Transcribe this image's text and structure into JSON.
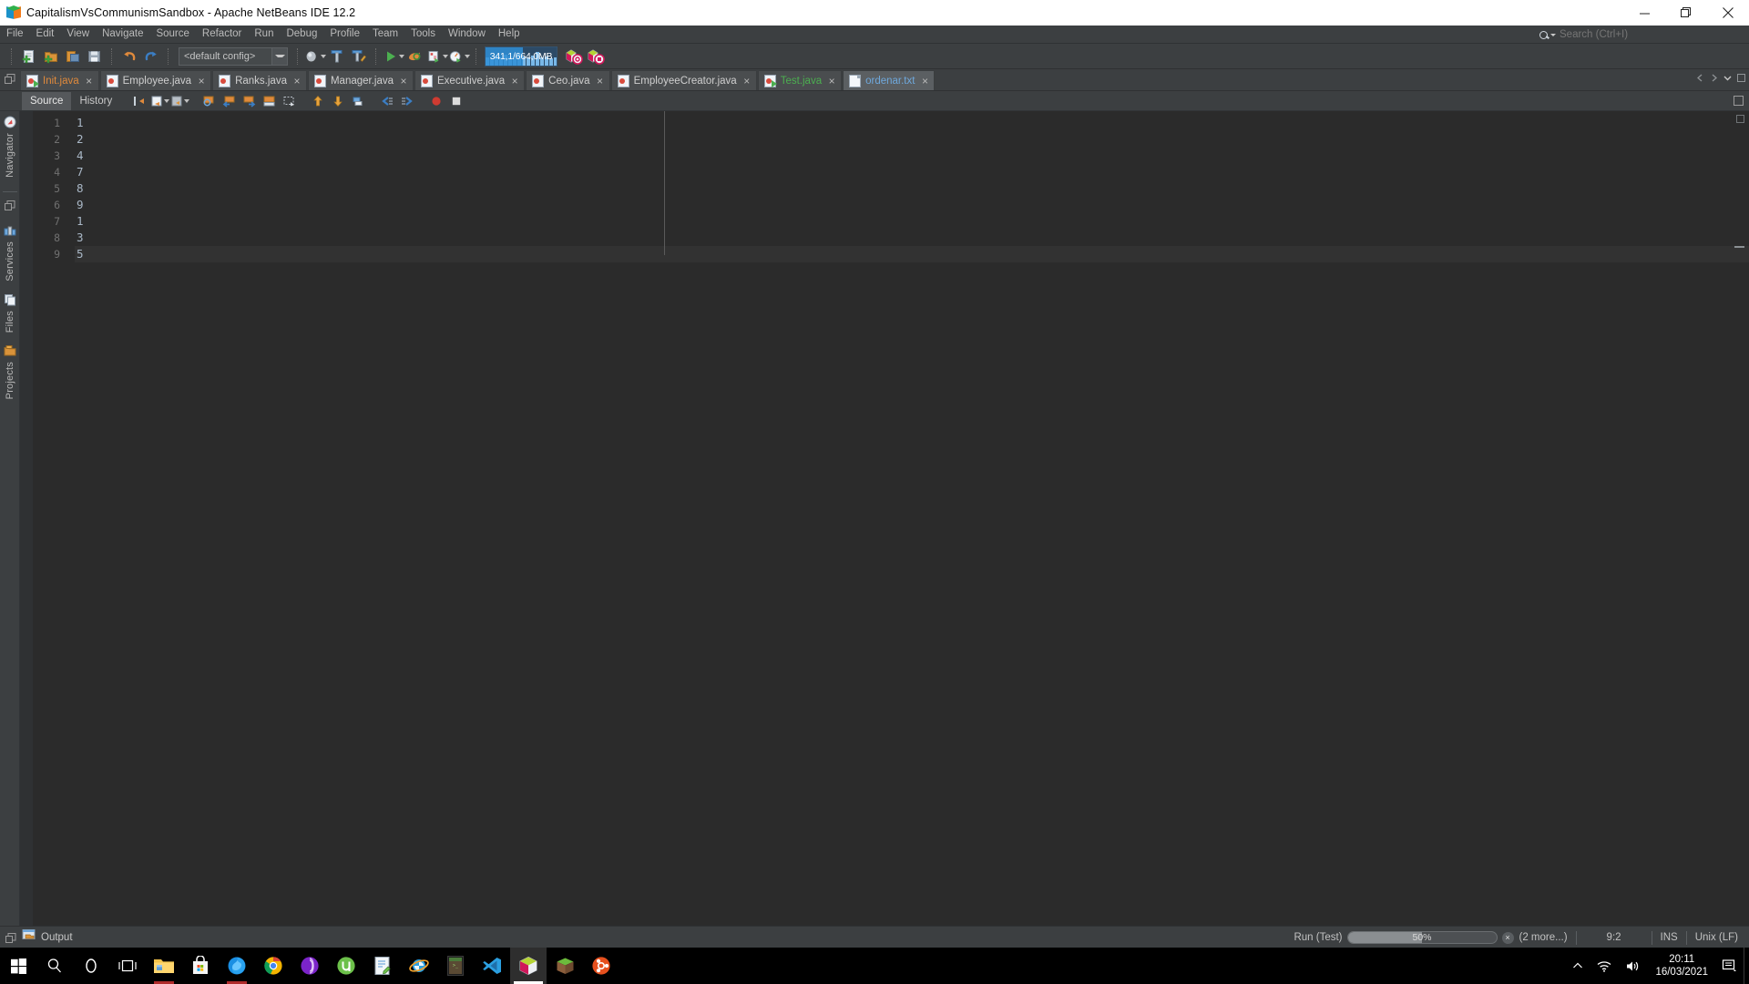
{
  "window": {
    "title": "CapitalismVsCommunismSandbox - Apache NetBeans IDE 12.2",
    "logo_name": "netbeans-logo",
    "minimize_label": "Minimize",
    "maximize_label": "Restore",
    "close_label": "Close"
  },
  "menubar": {
    "items": [
      {
        "label": "File",
        "mnemonic": "F"
      },
      {
        "label": "Edit",
        "mnemonic": "E"
      },
      {
        "label": "View",
        "mnemonic": "V"
      },
      {
        "label": "Navigate",
        "mnemonic": "N"
      },
      {
        "label": "Source",
        "mnemonic": "S"
      },
      {
        "label": "Refactor",
        "mnemonic": "R"
      },
      {
        "label": "Run",
        "mnemonic": "R"
      },
      {
        "label": "Debug",
        "mnemonic": "D"
      },
      {
        "label": "Profile",
        "mnemonic": "P"
      },
      {
        "label": "Team",
        "mnemonic": "m"
      },
      {
        "label": "Tools",
        "mnemonic": "T"
      },
      {
        "label": "Window",
        "mnemonic": "W"
      },
      {
        "label": "Help",
        "mnemonic": "H"
      }
    ]
  },
  "search": {
    "placeholder": "Search (Ctrl+I)",
    "value": "",
    "icon": "search-icon"
  },
  "toolbar": {
    "buttons": [
      {
        "name": "new-file-button",
        "icon": "new-file-icon"
      },
      {
        "name": "new-project-button",
        "icon": "new-project-icon"
      },
      {
        "name": "open-project-button",
        "icon": "open-project-icon"
      },
      {
        "name": "save-all-button",
        "icon": "save-all-icon"
      },
      {
        "name": "undo-button",
        "icon": "undo-icon"
      },
      {
        "name": "redo-button",
        "icon": "redo-icon"
      }
    ],
    "config_combo": {
      "value": "<default config>",
      "name": "project-configuration-combo"
    },
    "run_buttons": [
      {
        "name": "build-project-button",
        "icon": "hammer-icon"
      },
      {
        "name": "clean-build-button",
        "icon": "hammer-broom-icon"
      },
      {
        "name": "run-project-button",
        "icon": "run-play-icon"
      },
      {
        "name": "debug-project-button",
        "icon": "debug-icon"
      },
      {
        "name": "profile-project-button",
        "icon": "profile-icon"
      },
      {
        "name": "test-project-button",
        "icon": "gauge-icon"
      }
    ],
    "memory": {
      "label": "341,1/664,0MB",
      "percent": 52,
      "name": "heap-memory-gauge"
    },
    "right_buttons": [
      {
        "name": "profile-history-button",
        "icon": "profile-history-icon"
      },
      {
        "name": "profile-stop-button",
        "icon": "profile-stop-icon"
      }
    ]
  },
  "editor_tabs": {
    "items": [
      {
        "label": "Init.java",
        "icon": "java-main-file-icon",
        "color": "#e08a3c",
        "selected": false,
        "runnable": true
      },
      {
        "label": "Employee.java",
        "icon": "java-file-icon",
        "color": "#cfcfcf",
        "selected": false,
        "runnable": false
      },
      {
        "label": "Ranks.java",
        "icon": "java-file-icon",
        "color": "#cfcfcf",
        "selected": false,
        "runnable": false
      },
      {
        "label": "Manager.java",
        "icon": "java-file-icon",
        "color": "#cfcfcf",
        "selected": false,
        "runnable": false
      },
      {
        "label": "Executive.java",
        "icon": "java-file-icon",
        "color": "#cfcfcf",
        "selected": false,
        "runnable": false
      },
      {
        "label": "Ceo.java",
        "icon": "java-file-icon",
        "color": "#cfcfcf",
        "selected": false,
        "runnable": false
      },
      {
        "label": "EmployeeCreator.java",
        "icon": "java-file-icon",
        "color": "#cfcfcf",
        "selected": false,
        "runnable": false
      },
      {
        "label": "Test.java",
        "icon": "java-main-file-icon",
        "color": "#4caf50",
        "selected": false,
        "runnable": true
      },
      {
        "label": "ordenar.txt",
        "icon": "text-file-icon",
        "color": "#6fa8dc",
        "selected": true,
        "runnable": false
      }
    ],
    "close_glyph": "×"
  },
  "editor_toolbar": {
    "tabs": [
      {
        "label": "Source",
        "active": true,
        "name": "tab-source"
      },
      {
        "label": "History",
        "active": false,
        "name": "tab-history"
      }
    ],
    "buttons": [
      {
        "name": "last-edit-button",
        "icon": "last-edit-icon"
      },
      {
        "name": "toggle-bookmark-button",
        "icon": "bookmark-icon"
      },
      {
        "name": "toggle-rect-select-button",
        "icon": "rect-select-icon"
      },
      {
        "name": "find-selection-button",
        "icon": "find-selection-icon"
      },
      {
        "name": "previous-bookmark-button",
        "icon": "arrow-left-icon"
      },
      {
        "name": "next-bookmark-button",
        "icon": "arrow-right-icon"
      },
      {
        "name": "toggle-highlight-button",
        "icon": "highlight-icon"
      },
      {
        "name": "rectangular-selection-button",
        "icon": "dashed-rect-icon"
      },
      {
        "name": "previous-error-button",
        "icon": "arrow-up-icon"
      },
      {
        "name": "next-error-button",
        "icon": "arrow-down-icon"
      },
      {
        "name": "shift-right-button",
        "icon": "shift-right-icon"
      },
      {
        "name": "back-button",
        "icon": "back-arrow-icon"
      },
      {
        "name": "forward-button",
        "icon": "forward-arrow-icon"
      },
      {
        "name": "record-macro-button",
        "icon": "record-icon"
      },
      {
        "name": "stop-macro-button",
        "icon": "stop-icon"
      }
    ],
    "right_button": {
      "name": "maximize-editor-button",
      "icon": "maximize-window-icon"
    }
  },
  "left_rail": {
    "items": [
      {
        "label": "Navigator",
        "icon": "compass-icon",
        "name": "sidebar-item-navigator"
      },
      {
        "label": "Services",
        "icon": "services-icon",
        "name": "sidebar-item-services"
      },
      {
        "label": "Files",
        "icon": "files-icon",
        "name": "sidebar-item-files"
      },
      {
        "label": "Projects",
        "icon": "projects-icon",
        "name": "sidebar-item-projects"
      }
    ],
    "top_icon": {
      "name": "window-group-icon",
      "icon": "window-group-icon"
    }
  },
  "editor": {
    "file": "ordenar.txt",
    "lines": [
      {
        "number": "1",
        "text": "1",
        "current": false
      },
      {
        "number": "2",
        "text": "2",
        "current": false
      },
      {
        "number": "3",
        "text": "4",
        "current": false
      },
      {
        "number": "4",
        "text": "7",
        "current": false
      },
      {
        "number": "5",
        "text": "8",
        "current": false
      },
      {
        "number": "6",
        "text": "9",
        "current": false
      },
      {
        "number": "7",
        "text": "1",
        "current": false
      },
      {
        "number": "8",
        "text": "3",
        "current": false
      },
      {
        "number": "9",
        "text": "5",
        "current": true
      }
    ]
  },
  "statusbar": {
    "output_label": "Output",
    "output_icon": "output-window-icon",
    "run_task_label": "Run (Test)",
    "progress_text": "50%",
    "progress_percent": 50,
    "cancel_glyph": "×",
    "more_tasks_label": "(2 more...)",
    "caret_position": "9:2",
    "insert_mode": "INS",
    "line_ending": "Unix (LF)"
  },
  "taskbar": {
    "icons": [
      {
        "name": "start-button",
        "icon": "windows-logo-icon"
      },
      {
        "name": "search-taskbar-button",
        "icon": "search-icon"
      },
      {
        "name": "cortana-button",
        "icon": "cortana-circle-icon"
      },
      {
        "name": "task-view-button",
        "icon": "task-view-icon"
      },
      {
        "name": "file-explorer-button",
        "icon": "folder-icon"
      },
      {
        "name": "microsoft-store-button",
        "icon": "store-bag-icon"
      },
      {
        "name": "firefox-button",
        "icon": "firefox-icon"
      },
      {
        "name": "chrome-button",
        "icon": "chrome-icon"
      },
      {
        "name": "opera-button",
        "icon": "opera-icon"
      },
      {
        "name": "utorrent-button",
        "icon": "utorrent-icon"
      },
      {
        "name": "notepad-button",
        "icon": "notepad-icon"
      },
      {
        "name": "internet-explorer-button",
        "icon": "internet-explorer-icon"
      },
      {
        "name": "terminal-button",
        "icon": "terminal-icon"
      },
      {
        "name": "vscode-button",
        "icon": "vscode-icon"
      },
      {
        "name": "netbeans-button",
        "icon": "netbeans-logo-icon"
      },
      {
        "name": "minecraft-button",
        "icon": "minecraft-grass-icon"
      },
      {
        "name": "ubuntu-button",
        "icon": "ubuntu-icon"
      }
    ],
    "tray": {
      "chevron": {
        "name": "show-hidden-icons-button",
        "icon": "chevron-up-icon"
      },
      "network": {
        "name": "network-button",
        "icon": "wifi-icon"
      },
      "volume": {
        "name": "volume-button",
        "icon": "speaker-icon"
      },
      "time": "20:11",
      "date": "16/03/2021",
      "notifications": {
        "name": "notifications-button",
        "icon": "notification-icon"
      }
    }
  },
  "colors": {
    "chrome": "#3c3f41",
    "editor_bg": "#2b2b2b",
    "accent_orange": "#e08a3c",
    "accent_green": "#4caf50",
    "accent_blue": "#6fa8dc"
  }
}
